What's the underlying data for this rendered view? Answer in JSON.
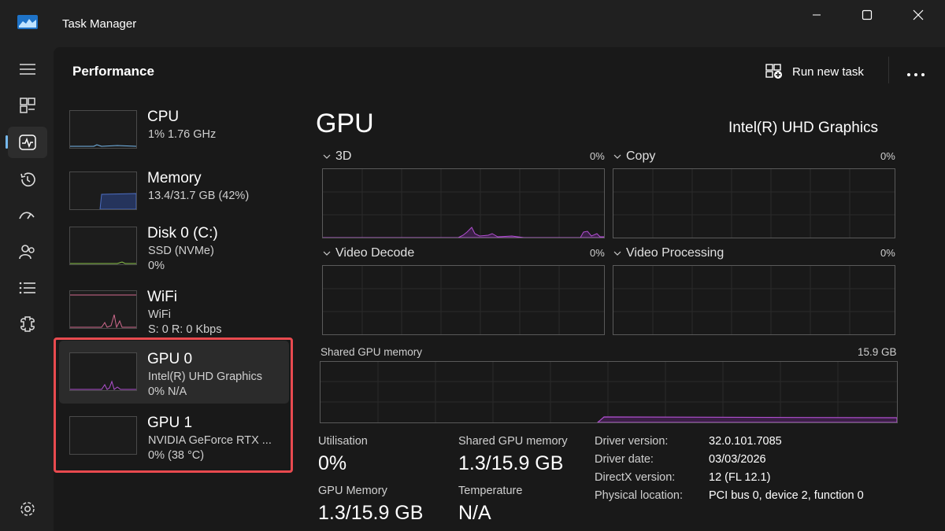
{
  "window": {
    "title": "Task Manager"
  },
  "window_controls": [
    "minimize",
    "maximize",
    "close"
  ],
  "nav": {
    "items": [
      "hamburger-icon",
      "processes-icon",
      "performance-icon",
      "app-history-icon",
      "startup-apps-icon",
      "users-icon",
      "details-icon",
      "services-icon",
      "settings-icon"
    ],
    "active": "performance-icon"
  },
  "header": {
    "title": "Performance",
    "run_task_label": "Run new task"
  },
  "sidebar": {
    "items": [
      {
        "name": "CPU",
        "line1": "1%  1.76 GHz",
        "line2": "",
        "color": "#76b9ed"
      },
      {
        "name": "Memory",
        "line1": "13.4/31.7 GB (42%)",
        "line2": "",
        "color": "#4d6ec2",
        "level": 0.42
      },
      {
        "name": "Disk 0 (C:)",
        "line1": "SSD (NVMe)",
        "line2": "0%",
        "color": "#8bc34a"
      },
      {
        "name": "WiFi",
        "line1": "WiFi",
        "line2": "S: 0  R: 0 Kbps",
        "color": "#d06a8e"
      },
      {
        "name": "GPU 0",
        "line1": "Intel(R) UHD Graphics",
        "line2": "0%  N/A",
        "color": "#b04fd0"
      },
      {
        "name": "GPU 1",
        "line1": "NVIDIA GeForce RTX ...",
        "line2": "0%  (38 °C)",
        "color": "#b04fd0"
      }
    ],
    "selected_index": 4
  },
  "gpu": {
    "title": "GPU",
    "model": "Intel(R) UHD Graphics",
    "accent_color": "#b04fd0",
    "engines": [
      {
        "label": "3D",
        "percent": "0%"
      },
      {
        "label": "Copy",
        "percent": "0%"
      },
      {
        "label": "Video Decode",
        "percent": "0%"
      },
      {
        "label": "Video Processing",
        "percent": "0%"
      }
    ],
    "shared_memory": {
      "label": "Shared GPU memory",
      "max": "15.9 GB",
      "used_fraction": 0.08
    }
  },
  "stats": {
    "utilisation": {
      "label": "Utilisation",
      "value": "0%"
    },
    "shared_gpu_memory": {
      "label": "Shared GPU memory",
      "value": "1.3/15.9 GB"
    },
    "gpu_memory": {
      "label": "GPU Memory",
      "value": "1.3/15.9 GB"
    },
    "temperature": {
      "label": "Temperature",
      "value": "N/A"
    }
  },
  "details": [
    {
      "key": "Driver version:",
      "value": "32.0.101.7085"
    },
    {
      "key": "Driver date:",
      "value": "03/03/2026"
    },
    {
      "key": "DirectX version:",
      "value": "12 (FL 12.1)"
    },
    {
      "key": "Physical location:",
      "value": "PCI bus 0, device 2, function 0"
    }
  ]
}
